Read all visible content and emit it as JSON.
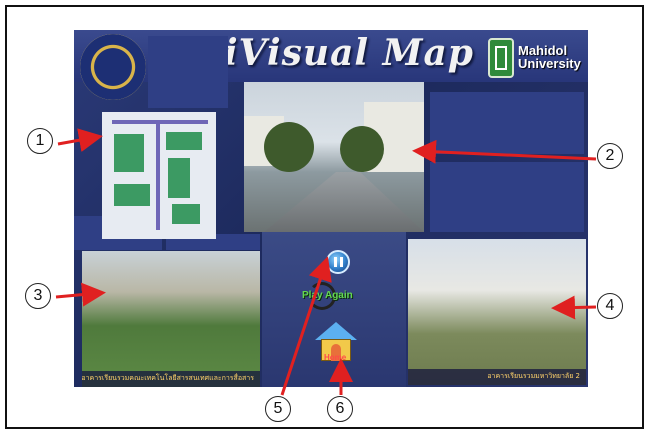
{
  "app": {
    "title": "iVisual Map",
    "partner_logo_text": [
      "Mahidol",
      "University"
    ]
  },
  "center": {
    "pause_icon": "pause-icon",
    "play_again_label": "Play Again",
    "home_label": "Home"
  },
  "photos": {
    "left_caption": "อาคารเรียนรวมคณะเทคโนโลยีสารสนเทศและการสื่อสาร",
    "right_caption": "อาคารเรียนรวมมหาวิทยาลัย 2"
  },
  "callouts": [
    "1",
    "2",
    "3",
    "4",
    "5",
    "6"
  ],
  "colors": {
    "app_background": "#26326a",
    "arrow": "#e02020",
    "play_again_text": "#63d84f",
    "home_text": "#ff4a4a"
  }
}
